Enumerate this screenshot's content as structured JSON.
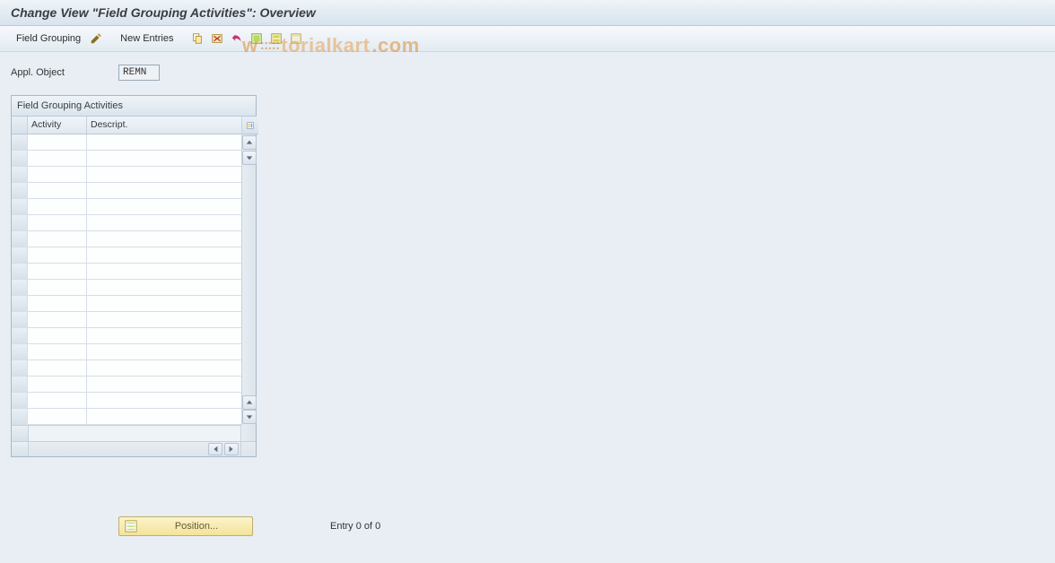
{
  "title": "Change View \"Field Grouping Activities\": Overview",
  "toolbar": {
    "field_grouping_label": "Field Grouping",
    "new_entries_label": "New Entries"
  },
  "form": {
    "appl_object_label": "Appl. Object",
    "appl_object_value": "REMN"
  },
  "table": {
    "title": "Field Grouping Activities",
    "columns": {
      "activity": "Activity",
      "descript": "Descript."
    },
    "row_count": 18
  },
  "footer": {
    "position_label": "Position...",
    "entry_status": "Entry 0 of 0"
  },
  "watermark": {
    "prefix": "w",
    "mid": "torialkart",
    "suffix": ".com"
  }
}
